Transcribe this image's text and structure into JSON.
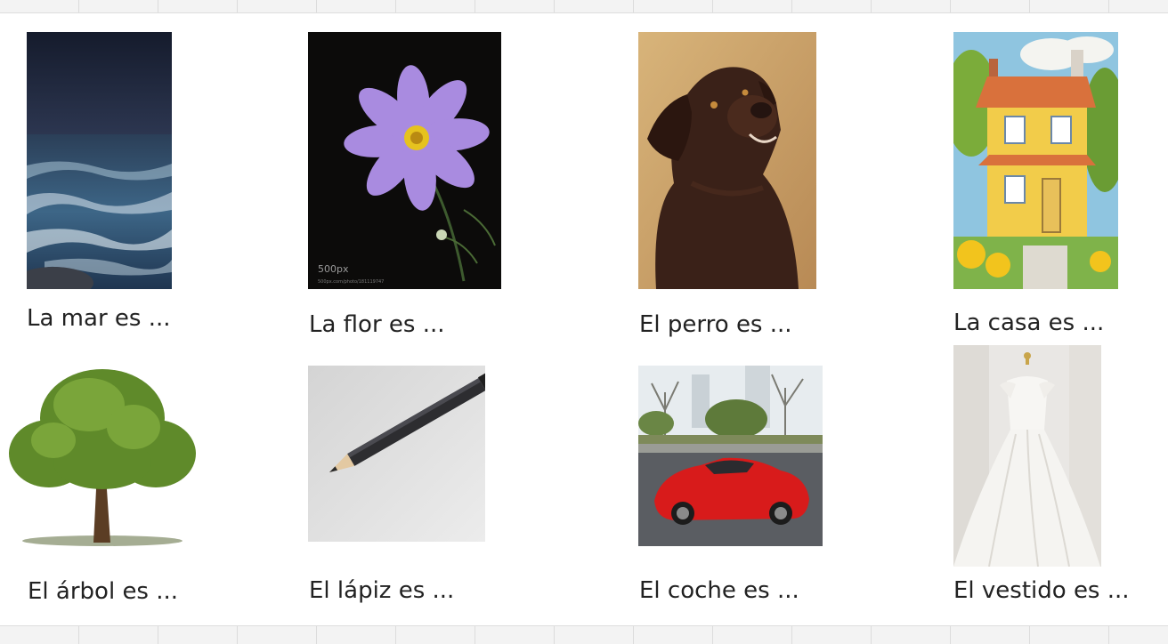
{
  "cards": [
    {
      "icon": "sea-waves-photo",
      "caption": "La mar es ..."
    },
    {
      "icon": "purple-flower-photo",
      "caption": "La flor es ..."
    },
    {
      "icon": "brown-dog-photo",
      "caption": "El perro es ..."
    },
    {
      "icon": "yellow-house-illustration",
      "caption": "La casa es ..."
    },
    {
      "icon": "oak-tree-photo",
      "caption": "El árbol es ..."
    },
    {
      "icon": "pencil-photo",
      "caption": "El lápiz es ..."
    },
    {
      "icon": "red-sports-car-photo",
      "caption": "El coche es ..."
    },
    {
      "icon": "wedding-dress-photo",
      "caption": "El vestido es ..."
    }
  ],
  "watermark": {
    "brand": "500px",
    "url": "500px.com/photo/181119747"
  },
  "colors": {
    "text": "#222222",
    "slide_background": "#ffffff",
    "grid_background": "#f3f3f3",
    "car_red": "#d81b1b",
    "flower_purple": "#a98be0",
    "house_yellow": "#f2cc4a"
  }
}
